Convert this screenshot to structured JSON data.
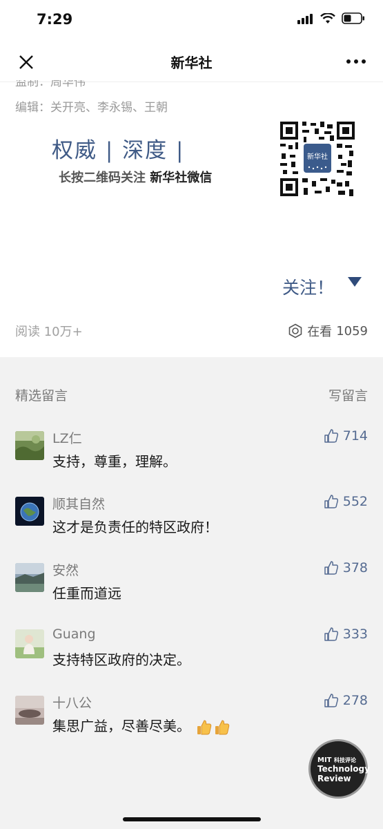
{
  "status": {
    "time": "7:29"
  },
  "nav": {
    "title": "新华社"
  },
  "article": {
    "partial_line": "监制：周华伟",
    "editor_line": "编辑：关开亮、李永锡、王朝",
    "banner_main": "权威 | 深度 |",
    "banner_sub_prefix": "长按二维码关注 ",
    "banner_sub_name": "新华社微信",
    "qr_logo": "新华社",
    "follow_label": "关注！",
    "read_label": "阅读 10万+",
    "watching_label": "在看",
    "watching_count": "1059"
  },
  "comments": {
    "header": "精选留言",
    "write_label": "写留言",
    "items": [
      {
        "name": "LZ仁",
        "text": "支持，尊重，理解。",
        "likes": "714"
      },
      {
        "name": "顺其自然",
        "text": "这才是负责任的特区政府！",
        "likes": "552"
      },
      {
        "name": "安然",
        "text": "任重而道远",
        "likes": "378"
      },
      {
        "name": "Guang",
        "text": "支持特区政府的决定。",
        "likes": "333"
      },
      {
        "name": "十八公",
        "text": "集思广益，尽善尽美。",
        "likes": "278"
      }
    ]
  },
  "watermark": {
    "line1": "MIT",
    "line1b": "科技评论",
    "line2": "Technology",
    "line3": "Review"
  },
  "colors": {
    "accent": "#3f5a86",
    "like": "#556b91",
    "bg_comments": "#f2f2f2"
  },
  "icons": [
    "close-icon",
    "more-icon",
    "wifi-icon",
    "battery-icon",
    "signal-icon",
    "watching-icon",
    "thumbs-up-icon",
    "triangle-down-icon"
  ]
}
